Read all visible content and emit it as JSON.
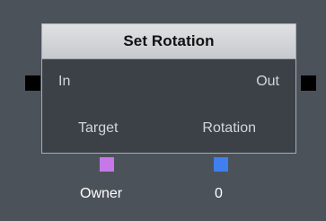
{
  "node": {
    "title": "Set Rotation",
    "pins": {
      "in_label": "In",
      "out_label": "Out",
      "target_label": "Target",
      "rotation_label": "Rotation"
    },
    "values": {
      "target": "Owner",
      "rotation": "0"
    }
  },
  "colors": {
    "target_port": "#c678e8",
    "rotation_port": "#3f7fef",
    "exec_port": "#000000"
  }
}
